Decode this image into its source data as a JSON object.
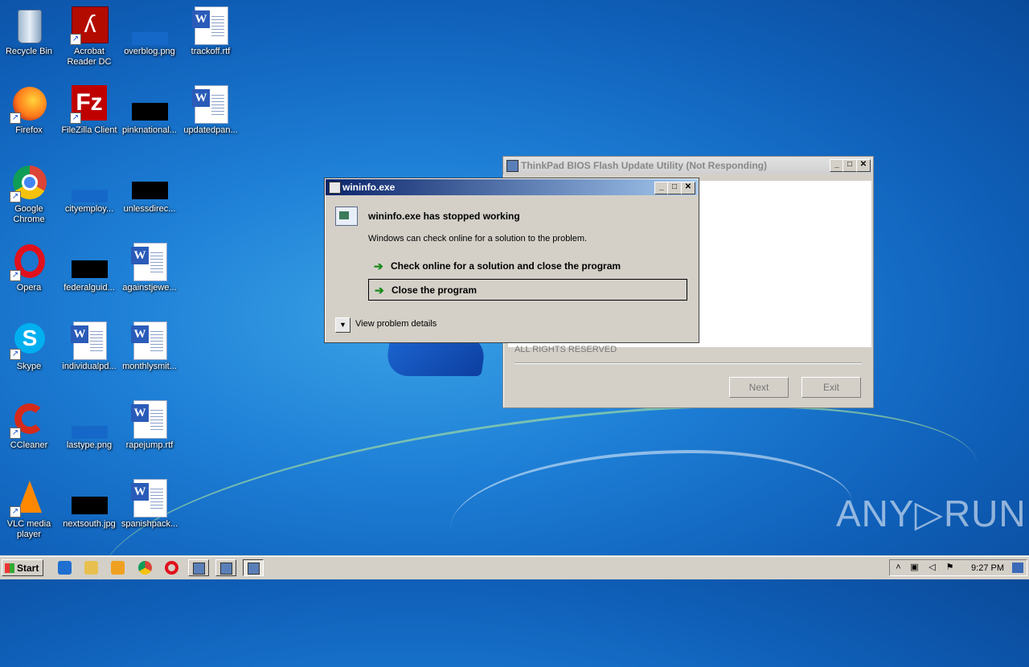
{
  "desktop_icons": [
    {
      "label": "Recycle Bin",
      "icon": "recycle-bin-icon"
    },
    {
      "label": "Acrobat Reader DC",
      "icon": "acrobat-icon"
    },
    {
      "label": "overblog.png",
      "icon": "png-file-icon"
    },
    {
      "label": "trackoff.rtf",
      "icon": "word-doc-icon"
    },
    {
      "label": "Firefox",
      "icon": "firefox-icon"
    },
    {
      "label": "FileZilla Client",
      "icon": "filezilla-icon"
    },
    {
      "label": "pinknational...",
      "icon": "image-file-icon"
    },
    {
      "label": "updatedpan...",
      "icon": "word-doc-icon"
    },
    {
      "label": "Google Chrome",
      "icon": "chrome-icon"
    },
    {
      "label": "cityemploy...",
      "icon": "image-file-icon"
    },
    {
      "label": "unlessdirec...",
      "icon": "image-file-icon"
    },
    {
      "label": "Opera",
      "icon": "opera-icon"
    },
    {
      "label": "federalguid...",
      "icon": "image-file-icon"
    },
    {
      "label": "againstjewe...",
      "icon": "word-doc-icon"
    },
    {
      "label": "Skype",
      "icon": "skype-icon"
    },
    {
      "label": "individualpd...",
      "icon": "word-doc-icon"
    },
    {
      "label": "monthlysmit...",
      "icon": "word-doc-icon"
    },
    {
      "label": "CCleaner",
      "icon": "ccleaner-icon"
    },
    {
      "label": "lastype.png",
      "icon": "png-file-icon"
    },
    {
      "label": "rapejump.rtf",
      "icon": "word-doc-icon"
    },
    {
      "label": "VLC media player",
      "icon": "vlc-icon"
    },
    {
      "label": "nextsouth.jpg",
      "icon": "image-file-icon"
    },
    {
      "label": "spanishpack...",
      "icon": "word-doc-icon"
    }
  ],
  "bios_window": {
    "title": "ThinkPad BIOS Flash Update Utility (Not Responding)",
    "copyright": "ALL RIGHTS RESERVED",
    "next_label": "Next",
    "exit_label": "Exit"
  },
  "error_dialog": {
    "title": "wininfo.exe",
    "heading": "wininfo.exe has stopped working",
    "subtext": "Windows can check online for a solution to the problem.",
    "option_check": "Check online for a solution and close the program",
    "option_close": "Close the program",
    "details_label": "View problem details"
  },
  "taskbar": {
    "start_label": "Start",
    "clock": "9:27 PM"
  },
  "watermark": "ANY▷RUN"
}
